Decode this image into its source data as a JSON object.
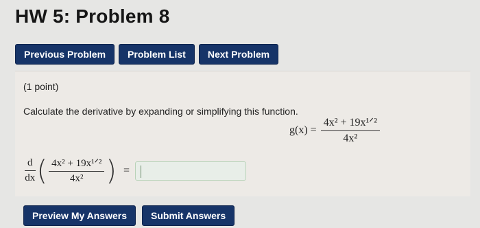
{
  "page": {
    "title": "HW 5: Problem 8"
  },
  "nav": {
    "previous_label": "Previous Problem",
    "list_label": "Problem List",
    "next_label": "Next Problem"
  },
  "problem": {
    "points": "(1 point)",
    "prompt": "Calculate the derivative by expanding or simplifying this function.",
    "function_lhs": "g(x) =",
    "numerator": "4x² + 19x¹ᐟ²",
    "denominator": "4x²",
    "deriv_d": "d",
    "deriv_dx": "dx",
    "equals": "=",
    "answer_value": ""
  },
  "actions": {
    "preview_label": "Preview My Answers",
    "submit_label": "Submit Answers"
  },
  "colors": {
    "button_bg": "#163468",
    "button_text": "#ffffff",
    "background": "#e6e6e4",
    "answer_border": "#b9d3b9"
  }
}
